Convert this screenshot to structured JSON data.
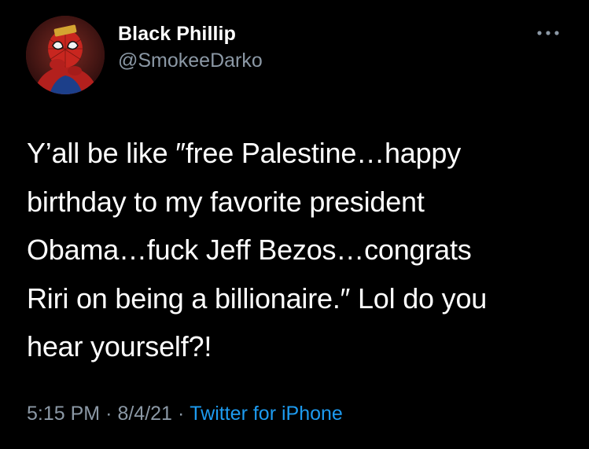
{
  "tweet": {
    "author": {
      "display_name": "Black Phillip",
      "handle": "@SmokeeDarko",
      "avatar_icon": "spiderman-avatar-icon"
    },
    "more_icon": "more-horizontal-icon",
    "text": "Y’all be like ″free Palestine…happy\nbirthday to my favorite president\nObama…fuck Jeff Bezos…congrats\nRiri on being a billionaire.″ Lol do you\nhear yourself?!",
    "meta": {
      "time": "5:15 PM",
      "separator": "·",
      "date": "8/4/21",
      "source": "Twitter for iPhone"
    }
  },
  "colors": {
    "background": "#000000",
    "primary_text": "#ffffff",
    "secondary_text": "#8b98a5",
    "link": "#1d9bf0"
  }
}
